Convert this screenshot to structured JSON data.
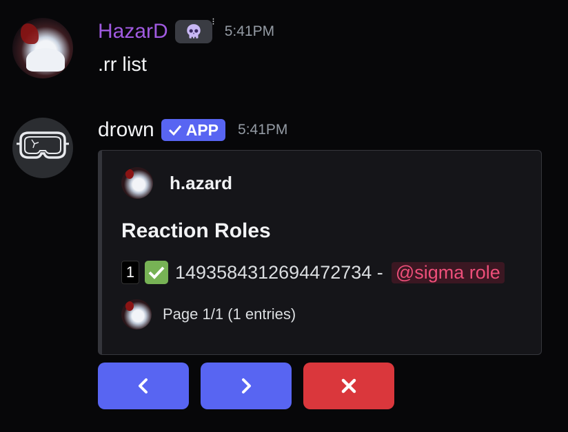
{
  "messages": [
    {
      "username": "HazarD",
      "badge_icon": "skull-icon",
      "time": "5:41PM",
      "content": ".rr list"
    },
    {
      "username": "drown",
      "app_badge": "APP",
      "time": "5:41PM",
      "embed": {
        "author": "h.azard",
        "title": "Reaction Roles",
        "entry": {
          "index": "1",
          "emoji": "check-mark-button-icon",
          "role_id": "1493584312694472734 -",
          "mention": "@sigma role"
        },
        "footer": "Page 1/1 (1 entries)"
      }
    }
  ],
  "buttons": [
    {
      "icon": "chevron-left-icon",
      "color": "#5865f2"
    },
    {
      "icon": "chevron-right-icon",
      "color": "#5865f2"
    },
    {
      "icon": "close-icon",
      "color": "#da373c"
    }
  ],
  "colors": {
    "username_accent": "#a05ae0",
    "app_badge": "#5865f2",
    "mention_text": "#ee4f7a",
    "mention_bg": "#3b1722",
    "background": "#070709"
  }
}
